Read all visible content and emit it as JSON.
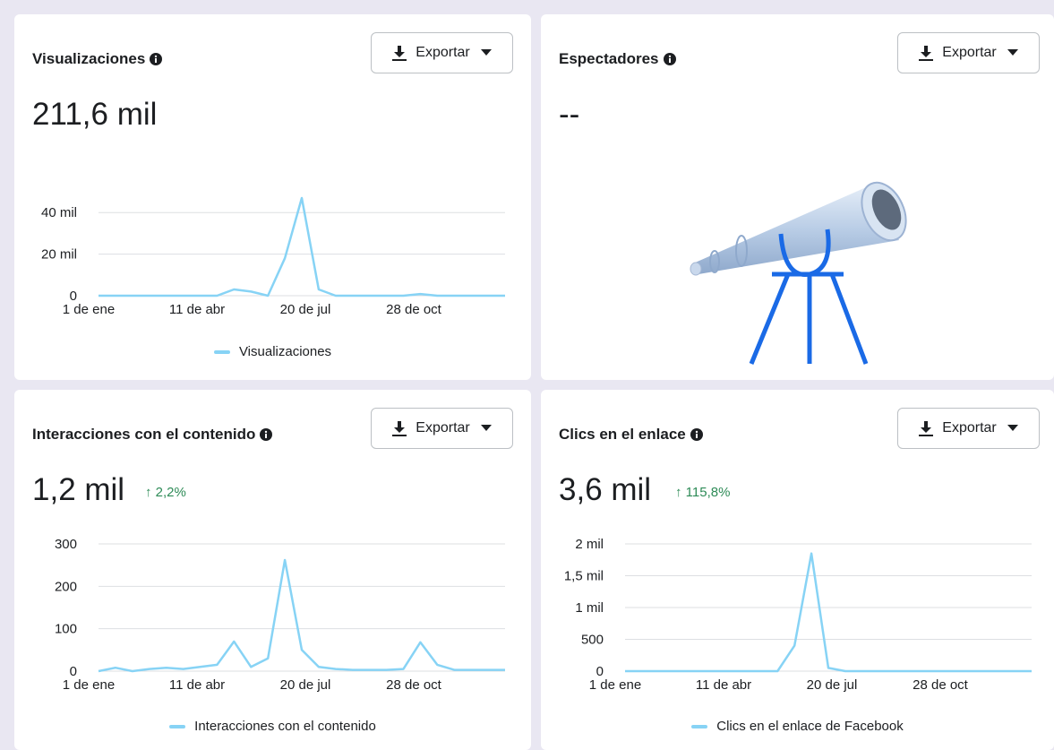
{
  "cards": [
    {
      "title": "Visualizaciones",
      "value": "211,6 mil",
      "export_label": "Exportar",
      "legend": "Visualizaciones"
    },
    {
      "title": "Espectadores",
      "value": "--",
      "export_label": "Exportar"
    },
    {
      "title": "Interacciones con el contenido",
      "value": "1,2 mil",
      "delta": "↑ 2,2%",
      "export_label": "Exportar",
      "legend": "Interacciones con el contenido"
    },
    {
      "title": "Clics en el enlace",
      "value": "3,6 mil",
      "delta": "↑ 115,8%",
      "export_label": "Exportar",
      "legend": "Clics en el enlace de Facebook"
    }
  ],
  "colors": {
    "line": "#87d3f5",
    "delta": "#2e8b57",
    "telescope": "#1a6ae6"
  },
  "icons": [
    "info-icon",
    "download-icon",
    "caret-down-icon",
    "telescope-illustration"
  ],
  "chart_data": [
    {
      "type": "line",
      "series": [
        {
          "name": "Visualizaciones",
          "values": [
            0,
            0,
            0,
            0,
            0,
            0,
            0,
            0,
            3000,
            2000,
            0,
            18000,
            47000,
            3000,
            0,
            0,
            0,
            0,
            0,
            800,
            0,
            0,
            0,
            0,
            0
          ]
        }
      ],
      "categories": [
        "1 de ene",
        "11 de abr",
        "20 de jul",
        "28 de oct"
      ],
      "yticks": [
        "0",
        "20 mil",
        "40 mil"
      ],
      "ylim": [
        0,
        50000
      ]
    },
    {
      "type": "line",
      "series": [
        {
          "name": "Interacciones con el contenido",
          "values": [
            0,
            8,
            0,
            5,
            8,
            5,
            10,
            15,
            70,
            10,
            30,
            262,
            50,
            10,
            5,
            3,
            3,
            3,
            5,
            68,
            15,
            3,
            3,
            3,
            3
          ]
        }
      ],
      "categories": [
        "1 de ene",
        "11 de abr",
        "20 de jul",
        "28 de oct"
      ],
      "yticks": [
        "0",
        "100",
        "200",
        "300"
      ],
      "ylim": [
        0,
        300
      ]
    },
    {
      "type": "line",
      "series": [
        {
          "name": "Clics en el enlace de Facebook",
          "values": [
            0,
            0,
            0,
            0,
            0,
            0,
            0,
            0,
            0,
            0,
            400,
            1850,
            50,
            0,
            0,
            0,
            0,
            0,
            0,
            0,
            0,
            0,
            0,
            0,
            0
          ]
        }
      ],
      "categories": [
        "1 de ene",
        "11 de abr",
        "20 de jul",
        "28 de oct"
      ],
      "yticks": [
        "0",
        "500",
        "1 mil",
        "1,5 mil",
        "2 mil"
      ],
      "ylim": [
        0,
        2000
      ]
    }
  ]
}
